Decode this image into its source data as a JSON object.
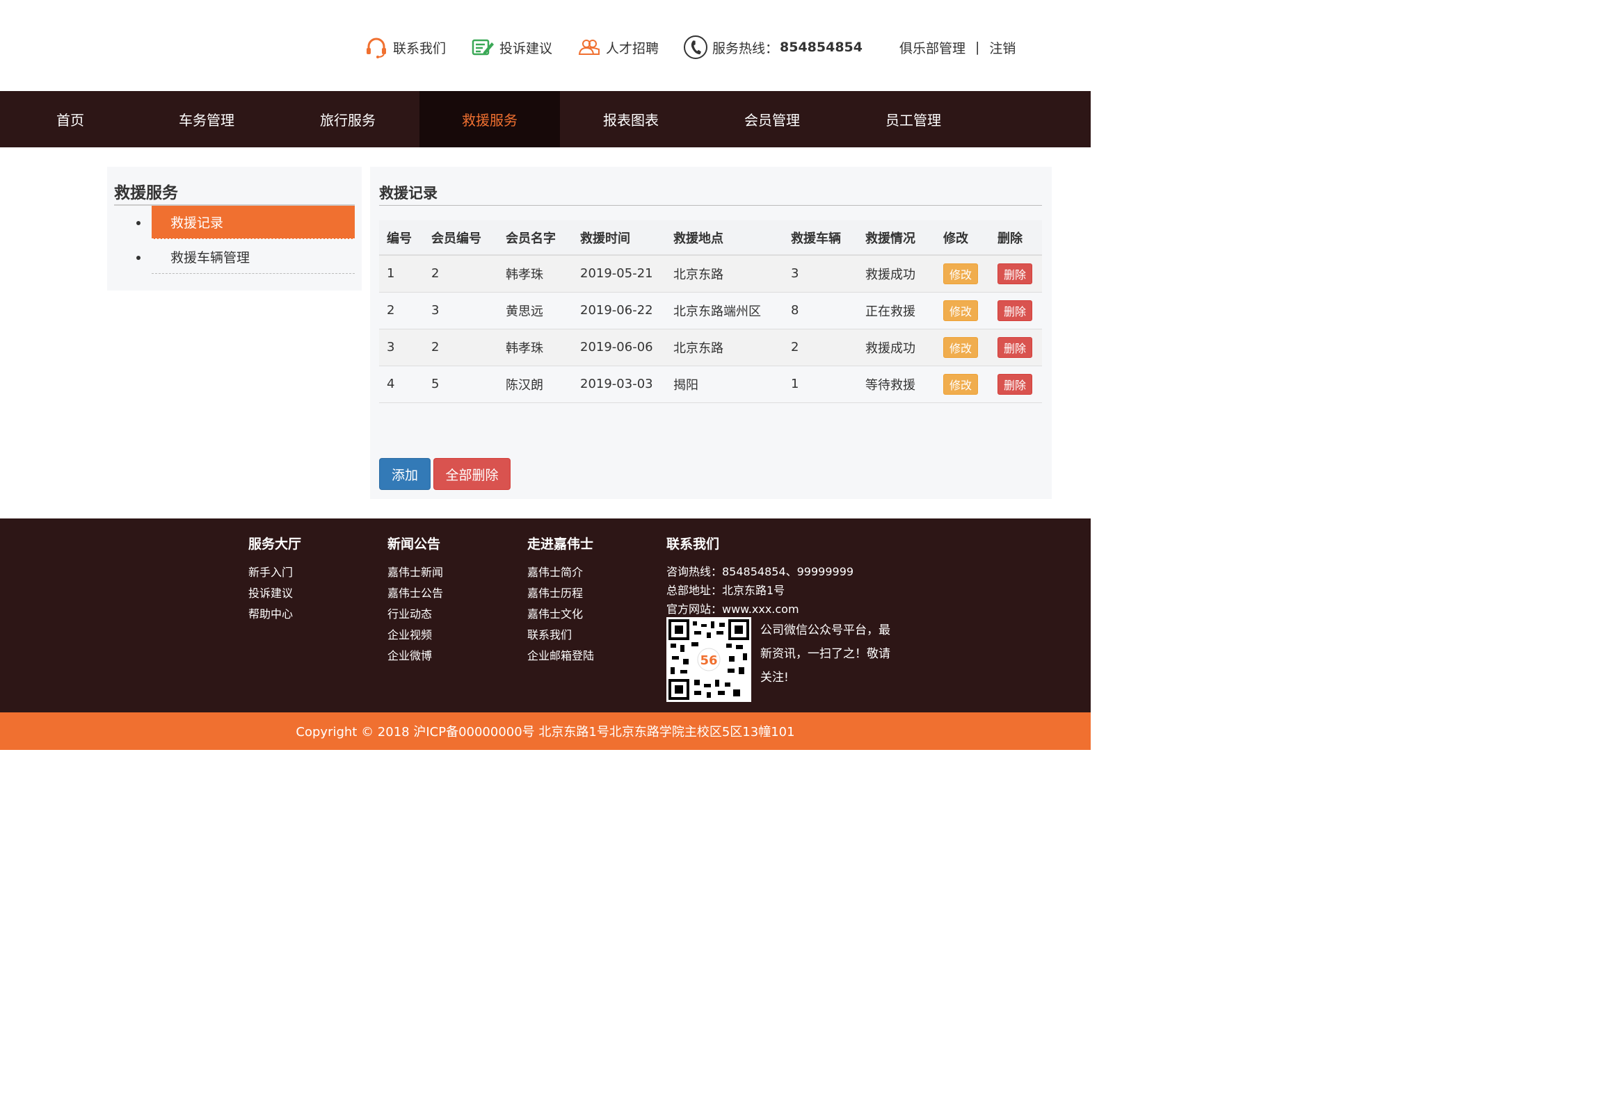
{
  "top": {
    "contact": "联系我们",
    "complaint": "投诉建议",
    "recruit": "人才招聘",
    "hotline_label": "服务热线：",
    "hotline_number": "854854854",
    "club": "俱乐部管理",
    "separator": "|",
    "logout": "注销",
    "icons": [
      "headset-icon",
      "edit-note-icon",
      "people-icon",
      "phone-icon"
    ],
    "icon_colors": {
      "headset": "#f07030",
      "edit": "#3aa856",
      "people": "#f07030",
      "phone": "#333333"
    }
  },
  "nav": {
    "items": [
      "首页",
      "车务管理",
      "旅行服务",
      "救援服务",
      "报表图表",
      "会员管理",
      "员工管理"
    ],
    "active": "救援服务"
  },
  "sidebar": {
    "title": "救援服务",
    "items": [
      "救援记录",
      "救援车辆管理"
    ],
    "active": "救援记录"
  },
  "panel": {
    "title": "救援记录",
    "columns": [
      "编号",
      "会员编号",
      "会员名字",
      "救援时间",
      "救援地点",
      "救援车辆",
      "救援情况",
      "修改",
      "删除"
    ],
    "rows": [
      [
        "1",
        "2",
        "韩孝珠",
        "2019-05-21",
        "北京东路",
        "3",
        "救援成功"
      ],
      [
        "2",
        "3",
        "黄思远",
        "2019-06-22",
        "北京东路端州区",
        "8",
        "正在救援"
      ],
      [
        "3",
        "2",
        "韩孝珠",
        "2019-06-06",
        "北京东路",
        "2",
        "救援成功"
      ],
      [
        "4",
        "5",
        "陈汉朗",
        "2019-03-03",
        "揭阳",
        "1",
        "等待救援"
      ]
    ],
    "edit_label": "修改",
    "delete_label": "删除",
    "add_label": "添加",
    "delete_all_label": "全部删除"
  },
  "footer": {
    "cols": [
      {
        "head": "服务大厅",
        "links": [
          "新手入门",
          "投诉建议",
          "帮助中心"
        ]
      },
      {
        "head": "新闻公告",
        "links": [
          "嘉伟士新闻",
          "嘉伟士公告",
          "行业动态",
          "企业视频",
          "企业微博"
        ]
      },
      {
        "head": "走进嘉伟士",
        "links": [
          "嘉伟士简介",
          "嘉伟士历程",
          "嘉伟士文化",
          "联系我们",
          "企业邮箱登陆"
        ]
      }
    ],
    "contact_head": "联系我们",
    "contact_lines": [
      "咨询热线：854854854、99999999",
      "总部地址：北京东路1号",
      "官方网站：www.xxx.com"
    ],
    "qr_text": "公司微信公众号平台，最新资讯，一扫了之！敬请关注!"
  },
  "copyright": "Copyright © 2018 沪ICP备00000000号 北京东路1号北京东路学院主校区5区13幢101",
  "colors": {
    "brand": "#f07030",
    "nav_bg": "#2d1616",
    "primary": "#337ab7",
    "danger": "#d9534f",
    "warning": "#f0ad4e"
  }
}
